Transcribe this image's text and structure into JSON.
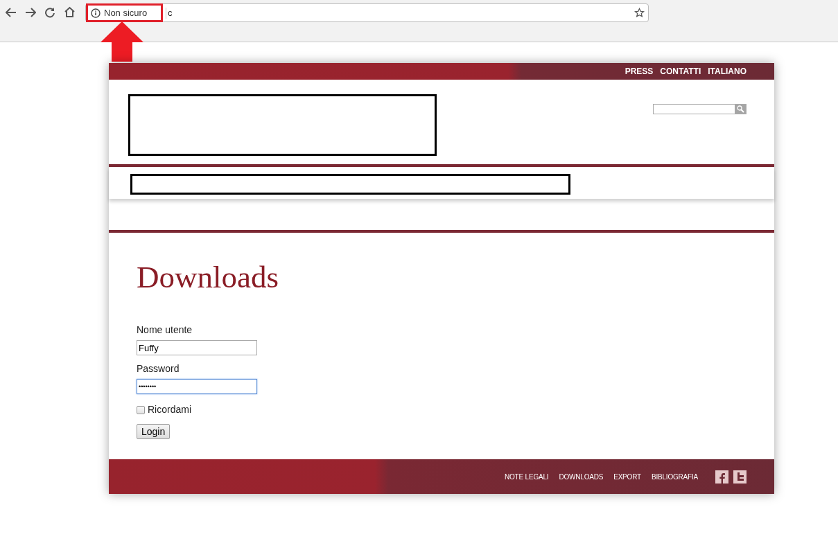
{
  "browser": {
    "security_label": "Non sicuro",
    "address": "c"
  },
  "top_links": [
    "PRESS",
    "CONTATTI",
    "ITALIANO"
  ],
  "page_title": "Downloads",
  "login": {
    "username_label": "Nome utente",
    "username_value": "Fuffy",
    "password_label": "Password",
    "password_value": "••••••••",
    "password_focused": true,
    "remember_label": "Ricordami",
    "remember_checked": false,
    "submit": "Login"
  },
  "footer_links": [
    "NOTE LEGALI",
    "DOWNLOADS",
    "EXPORT",
    "BIBLIOGRAFIA"
  ]
}
